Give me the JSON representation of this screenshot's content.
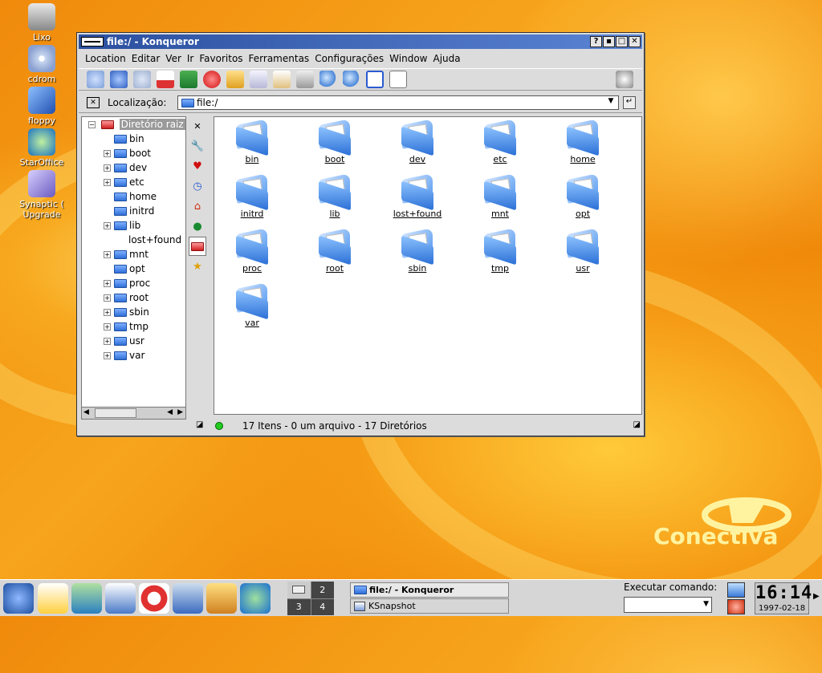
{
  "desktop": {
    "icons": [
      {
        "label": "Lixo",
        "icon": "trash-icon"
      },
      {
        "label": "cdrom",
        "icon": "cdrom-icon"
      },
      {
        "label": "floppy",
        "icon": "floppy-icon"
      },
      {
        "label": "StarOffice",
        "icon": "staroffice-icon"
      },
      {
        "label": "Synaptic ( Upgrade",
        "icon": "synaptic-icon"
      }
    ],
    "brand": "Conectiva"
  },
  "window": {
    "title": "file:/ - Konqueror",
    "buttons": {
      "help": "?",
      "minimize": "▪",
      "maximize": "□",
      "close": "✕"
    },
    "menu": [
      "Location",
      "Editar",
      "Ver",
      "Ir",
      "Favoritos",
      "Ferramentas",
      "Configurações",
      "Window",
      "Ajuda"
    ],
    "location_label": "Localização:",
    "location_value": "file:/",
    "tree_root": "Diretório raiz",
    "tree": [
      {
        "name": "bin",
        "expandable": false
      },
      {
        "name": "boot",
        "expandable": true
      },
      {
        "name": "dev",
        "expandable": true
      },
      {
        "name": "etc",
        "expandable": true
      },
      {
        "name": "home",
        "expandable": false
      },
      {
        "name": "initrd",
        "expandable": false
      },
      {
        "name": "lib",
        "expandable": true
      },
      {
        "name": "lost+found",
        "expandable": false
      },
      {
        "name": "mnt",
        "expandable": true
      },
      {
        "name": "opt",
        "expandable": false
      },
      {
        "name": "proc",
        "expandable": true
      },
      {
        "name": "root",
        "expandable": true
      },
      {
        "name": "sbin",
        "expandable": true
      },
      {
        "name": "tmp",
        "expandable": true
      },
      {
        "name": "usr",
        "expandable": true
      },
      {
        "name": "var",
        "expandable": true
      }
    ],
    "files": [
      "bin",
      "boot",
      "dev",
      "etc",
      "home",
      "initrd",
      "lib",
      "lost+found",
      "mnt",
      "opt",
      "proc",
      "root",
      "sbin",
      "tmp",
      "usr",
      "var"
    ],
    "status": "17 Itens - 0 um arquivo - 17 Diretórios"
  },
  "taskbar": {
    "pager": [
      "1",
      "2",
      "3",
      "4"
    ],
    "tasks": [
      "file:/ - Konqueror",
      "KSnapshot"
    ],
    "run_label": "Executar comando:",
    "clock_time": "16:14",
    "clock_date": "1997-02-18"
  }
}
